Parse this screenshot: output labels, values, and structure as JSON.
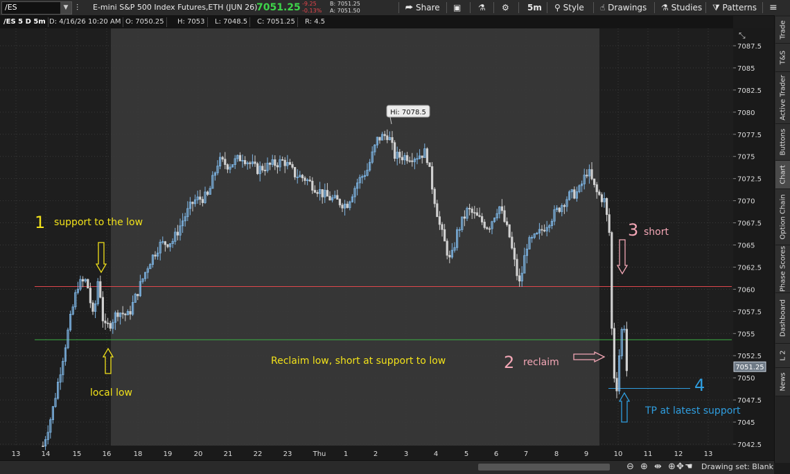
{
  "toolbar": {
    "symbol": "/ES",
    "description": "E-mini S&P 500 Index Futures,ETH (JUN 26)",
    "last_price": "7051.25",
    "net_change": "-9.25",
    "pct_change": "-0.13%",
    "bid": "B: 7051.25",
    "ask": "A: 7051.50",
    "share_label": "Share",
    "timeframe_label": "5m",
    "style_label": "Style",
    "drawings_label": "Drawings",
    "studies_label": "Studies",
    "patterns_label": "Patterns",
    "icons": [
      "dropdown-arrow",
      "link-icon",
      "share-icon",
      "screenshot-icon",
      "flask-icon",
      "gear-icon",
      "style-icon",
      "drawings-hand-icon",
      "studies-flask-icon",
      "patterns-icon",
      "menu-icon"
    ]
  },
  "infobar": {
    "title": "/ES 5 D 5m",
    "date": "D: 4/16/26 10:20 AM",
    "open": "O: 7050.25",
    "high": "H: 7053",
    "low": "L: 7048.5",
    "close": "C: 7051.25",
    "range": "R: 4.5"
  },
  "chart_data": {
    "type": "candlestick",
    "title": "/ES 5 D 5m",
    "y_ticks": [
      "7087.5",
      "7085",
      "7082.5",
      "7080",
      "7077.5",
      "7075",
      "7072.5",
      "7070",
      "7067.5",
      "7065",
      "7062.5",
      "7060",
      "7057.5",
      "7055",
      "7052.5",
      "7050",
      "7047.5",
      "7045",
      "7042.5"
    ],
    "ylim": [
      7042.0,
      7090.0
    ],
    "x_ticks": [
      "13",
      "14",
      "15",
      "16",
      "18",
      "19",
      "20",
      "21",
      "22",
      "23",
      "Thu",
      "1",
      "2",
      "3",
      "4",
      "5",
      "6",
      "7",
      "8",
      "9",
      "10",
      "11",
      "12",
      "13"
    ],
    "current_price_label": "7051.25",
    "hi_label": "Hi: 7078.5",
    "hi_value": 7078.5,
    "horizontal_lines": [
      {
        "value": 7060.3,
        "color": "#e0474c"
      },
      {
        "value": 7054.3,
        "color": "#3cb043"
      },
      {
        "value": 7048.8,
        "color": "#2f9ee0"
      }
    ],
    "annotations": [
      {
        "num": "1",
        "text": "support to the low",
        "color": "#f2e21a"
      },
      {
        "num": "",
        "text": "local low",
        "color": "#f2e21a"
      },
      {
        "num": "",
        "text": "Reclaim low, short at support to low",
        "color": "#f2e21a"
      },
      {
        "num": "2",
        "text": "reclaim",
        "color": "#f4a7b6"
      },
      {
        "num": "3",
        "text": "short",
        "color": "#f4a7b6"
      },
      {
        "num": "4",
        "text": "",
        "color": "#2f9ee0"
      },
      {
        "num": "",
        "text": "TP at latest support",
        "color": "#2f9ee0"
      }
    ],
    "colors": {
      "background_off_session": "#1e1e1e",
      "background_session": "#363636",
      "up_candle": "#7fb8e8",
      "down_candle": "#d0d0d0",
      "grid": "#3a3a3a"
    }
  },
  "right_tabs": [
    "Trade",
    "T&S",
    "Active Trader",
    "Buttons",
    "Chart",
    "Option Chain",
    "Phase Scores",
    "Dashboard",
    "L 2",
    "News"
  ],
  "bottom": {
    "drawing_set": "Drawing set: Blank",
    "icons": [
      "zoom-out-icon",
      "zoom-in-icon",
      "pan-icon",
      "crosshair-icon",
      "move-icon",
      "hand-icon"
    ]
  }
}
